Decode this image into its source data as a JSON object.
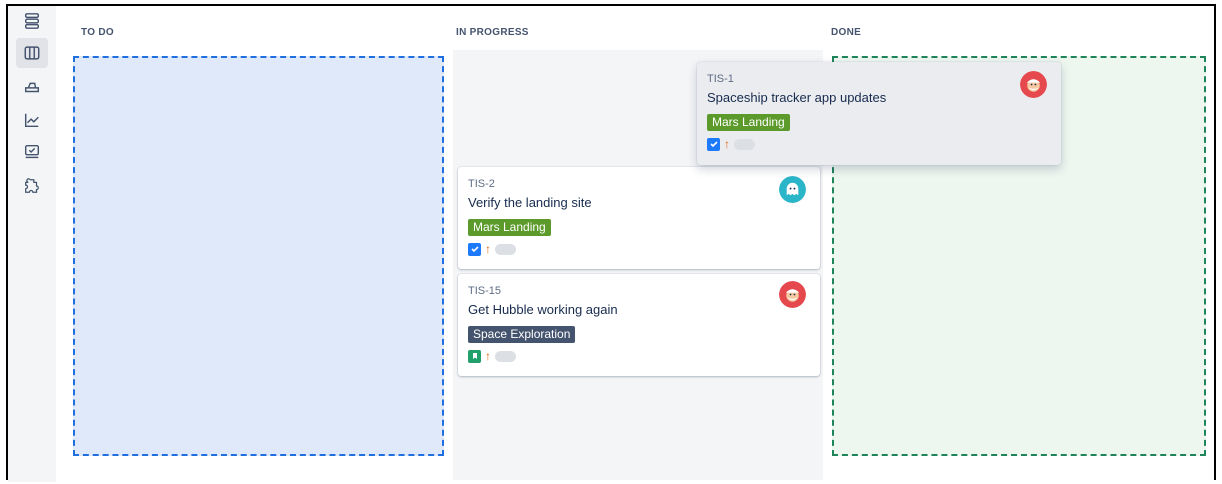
{
  "columns": {
    "todo": "TO DO",
    "in_progress": "IN PROGRESS",
    "done": "DONE"
  },
  "sidebar": {
    "items": [
      {
        "icon": "backlog-icon"
      },
      {
        "icon": "board-icon",
        "active": true
      },
      {
        "icon": "releases-icon"
      },
      {
        "icon": "reports-icon"
      },
      {
        "icon": "issues-icon"
      },
      {
        "icon": "apps-icon"
      }
    ]
  },
  "cards": [
    {
      "key": "TIS-1",
      "title": "Spaceship tracker app updates",
      "label": "Mars Landing",
      "label_color": "#5b9a2b",
      "type": "task",
      "priority": "↑",
      "avatar": "santa-avatar",
      "dragging": true
    },
    {
      "key": "TIS-2",
      "title": "Verify the landing site",
      "label": "Mars Landing",
      "label_color": "#5b9a2b",
      "type": "task",
      "priority": "↑",
      "avatar": "ghost-avatar"
    },
    {
      "key": "TIS-15",
      "title": "Get Hubble working again",
      "label": "Space Exploration",
      "label_color": "#44546f",
      "type": "story",
      "priority": "↑",
      "avatar": "santa-avatar"
    }
  ],
  "colors": {
    "task": "#1d7afc",
    "story": "#22a06b",
    "priority": "#e56910",
    "todo_drop_border": "#1f6fe0",
    "done_drop_border": "#1f845a"
  }
}
